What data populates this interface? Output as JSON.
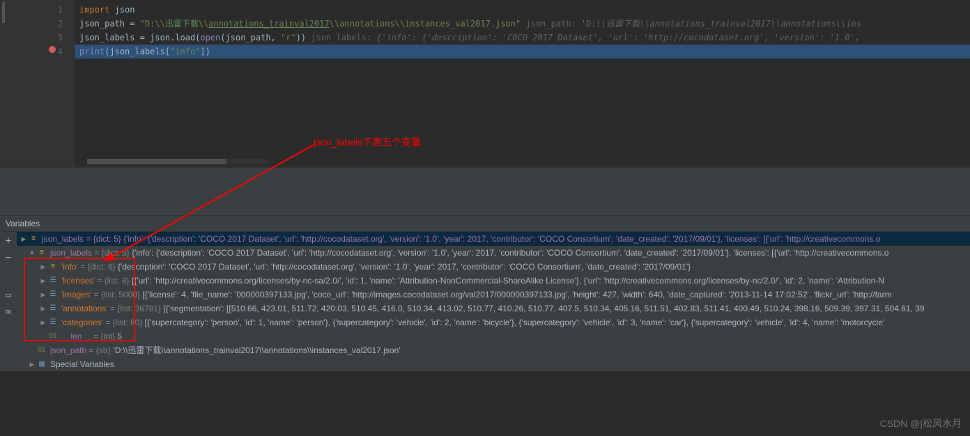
{
  "code": {
    "lines": [
      "1",
      "2",
      "3",
      "4"
    ],
    "l1_import": "import",
    "l1_mod": " json",
    "l2_var": "json_path = ",
    "l2_str_a": "\"D:\\\\迅雷下载\\\\",
    "l2_str_b": "annotations_trainval2017",
    "l2_str_c": "\\\\annotations\\\\instances_val2017.json\"",
    "l2_hint_label": "   json_path: ",
    "l2_hint_val": "'D:\\\\迅雷下载\\\\annotations_trainval2017\\\\annotations\\\\ins",
    "l3_a": "json_labels = json.load(",
    "l3_open": "open",
    "l3_b": "(json_path, ",
    "l3_str": "\"r\"",
    "l3_c": "))",
    "l3_hint_label": "   json_labels: ",
    "l3_hint_val": "{'info': {'description': 'COCO 2017 Dataset', 'url': 'http://cocodataset.org', 'version': '1.0',",
    "l4_print": "print",
    "l4_a": "(json_labels[",
    "l4_str": "\"info\"",
    "l4_b": "])"
  },
  "annotation_text": "json_labels下面五个变量",
  "variables_title": "Variables",
  "tree": {
    "root_selected": "json_labels = {dict: 5} {'info': {'description': 'COCO 2017 Dataset', 'url': 'http://cocodataset.org', 'version': '1.0', 'year': 2017, 'contributor': 'COCO Consortium', 'date_created': '2017/09/01'}, 'licenses': [{'url': 'http://creativecommons.o",
    "root_open_name": "json_labels",
    "root_open_type": " = {dict: 5}",
    "root_open_val": " {'info': {'description': 'COCO 2017 Dataset', 'url': 'http://cocodataset.org', 'version': '1.0', 'year': 2017, 'contributor': 'COCO Consortium', 'date_created': '2017/09/01'}, 'licenses': [{'url': 'http://creativecommons.o",
    "info_name": "'info'",
    "info_type": " = {dict: 6}",
    "info_val": " {'description': 'COCO 2017 Dataset', 'url': 'http://cocodataset.org', 'version': '1.0', 'year': 2017, 'contributor': 'COCO Consortium', 'date_created': '2017/09/01'}",
    "lic_name": "'licenses'",
    "lic_type": " = {list: 8}",
    "lic_val": " [{'url': 'http://creativecommons.org/licenses/by-nc-sa/2.0/', 'id': 1, 'name': 'Attribution-NonCommercial-ShareAlike License'}, {'url': 'http://creativecommons.org/licenses/by-nc/2.0/', 'id': 2, 'name': 'Attribution-N",
    "img_name": "'images'",
    "img_type": " = {list: 5000}",
    "img_val": " [{'license': 4, 'file_name': '000000397133.jpg', 'coco_url': 'http://images.cocodataset.org/val2017/000000397133.jpg', 'height': 427, 'width': 640, 'date_captured': '2013-11-14 17:02:52', 'flickr_url': 'http://farm",
    "ann_name": "'annotations'",
    "ann_type": " = {list: 36781}",
    "ann_val": " [{'segmentation': [[510.66, 423.01, 511.72, 420.03, 510.45, 416.0, 510.34, 413.02, 510.77, 410.26, 510.77, 407.5, 510.34, 405.16, 511.51, 402.83, 511.41, 400.49, 510.24, 398.16, 509.39, 397.31, 504.61, 39",
    "cat_name": "'categories'",
    "cat_type": " = {list: 80}",
    "cat_val": " [{'supercategory': 'person', 'id': 1, 'name': 'person'}, {'supercategory': 'vehicle', 'id': 2, 'name': 'bicycle'}, {'supercategory': 'vehicle', 'id': 3, 'name': 'car'}, {'supercategory': 'vehicle', 'id': 4, 'name': 'motorcycle'",
    "len_name": "__len__",
    "len_type": " = {int}",
    "len_val": " 5",
    "path_name": "json_path",
    "path_type": " = {str}",
    "path_val": " 'D:\\\\迅雷下载\\\\annotations_trainval2017\\\\annotations\\\\instances_val2017.json'",
    "special": "Special Variables"
  },
  "watermark": "CSDN @|松风水月"
}
